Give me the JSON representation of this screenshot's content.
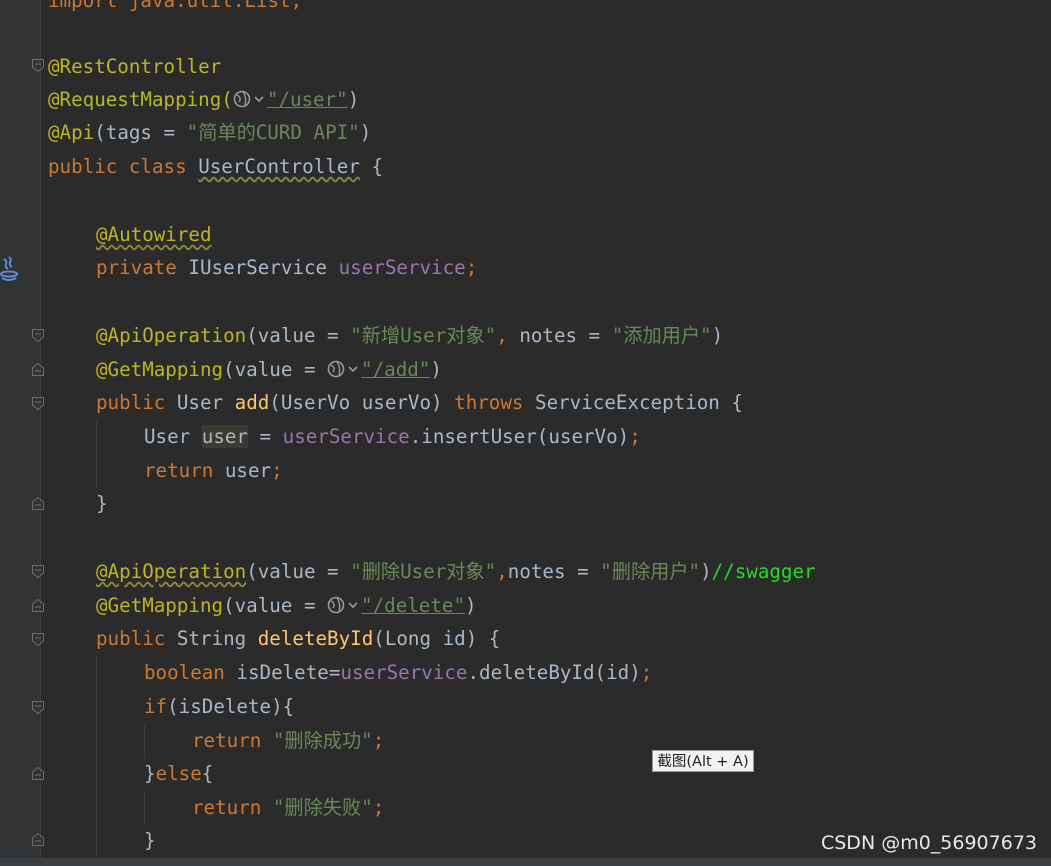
{
  "code": {
    "import_line": "import java.util.List;",
    "l_restcontroller": "@RestController",
    "l_requestmapping_pre": "@RequestMapping(",
    "l_requestmapping_path": "\"/user\"",
    "l_requestmapping_post": ")",
    "l_api_pre": "@Api",
    "l_api_mid": "(tags = ",
    "l_api_str": "\"简单的CURD API\"",
    "l_api_post": ")",
    "l_class_kw": "public class ",
    "l_class_name": "UserController",
    "l_class_brace": " {",
    "l_autowired": "@Autowired",
    "l_private_kw": "private ",
    "l_private_type": "IUserService ",
    "l_private_field": "userService",
    "l_private_semi": ";",
    "l_apiop1_an": "@ApiOperation",
    "l_apiop1_a": "(value = ",
    "l_apiop1_s1": "\"新增User对象\"",
    "l_apiop1_comma": ", ",
    "l_apiop1_b": "notes = ",
    "l_apiop1_s2": "\"添加用户\"",
    "l_apiop1_post": ")",
    "l_getmap1_an": "@GetMapping",
    "l_getmap1_a": "(value = ",
    "l_getmap1_path": "\"/add\"",
    "l_getmap1_post": ")",
    "l_add_kw": "public ",
    "l_add_type": "User ",
    "l_add_fn": "add",
    "l_add_params": "(UserVo userVo) ",
    "l_add_throws": "throws ",
    "l_add_exc": "ServiceException {",
    "l_user_type": "User ",
    "l_user_var": "user",
    "l_user_eq": " = ",
    "l_user_svc": "userService",
    "l_user_call": ".insertUser(userVo)",
    "l_user_semi": ";",
    "l_ret1_kw": "return ",
    "l_ret1_val": "user",
    "l_ret1_semi": ";",
    "l_close1": "}",
    "l_apiop2_an": "@ApiOperation",
    "l_apiop2_a": "(value = ",
    "l_apiop2_s1": "\"删除User对象\"",
    "l_apiop2_comma": ",",
    "l_apiop2_b": "notes = ",
    "l_apiop2_s2": "\"删除用户\"",
    "l_apiop2_post": ")",
    "l_apiop2_comment": "//swagger",
    "l_getmap2_an": "@GetMapping",
    "l_getmap2_a": "(value = ",
    "l_getmap2_path": "\"/delete\"",
    "l_getmap2_post": ")",
    "l_del_kw": "public ",
    "l_del_type": "String ",
    "l_del_fn": "deleteById",
    "l_del_params": "(Long id) {",
    "l_bool_kw": "boolean ",
    "l_bool_var": "isDelete=",
    "l_bool_svc": "userService",
    "l_bool_call": ".deleteById(id)",
    "l_bool_semi": ";",
    "l_if_kw": "if",
    "l_if_cond": "(isDelete){",
    "l_ret2_kw": "return ",
    "l_ret2_str": "\"删除成功\"",
    "l_ret2_semi": ";",
    "l_else_pre": "}",
    "l_else_kw": "else",
    "l_else_post": "{",
    "l_ret3_kw": "return ",
    "l_ret3_str": "\"删除失败\"",
    "l_ret3_semi": ";",
    "l_close2": "}"
  },
  "tooltip": "截图(Alt + A)",
  "watermark": "CSDN @m0_56907673",
  "icons": {
    "gutter_class_icon": "java-class-icon",
    "url_icon": "globe-icon"
  },
  "colors": {
    "background": "#2b2b2b",
    "keyword": "#cc7832",
    "annotation": "#bbb529",
    "string": "#6a8759",
    "field": "#9876aa",
    "method": "#ffc66d",
    "text": "#a9b7c6",
    "comment": "#22dd22"
  }
}
